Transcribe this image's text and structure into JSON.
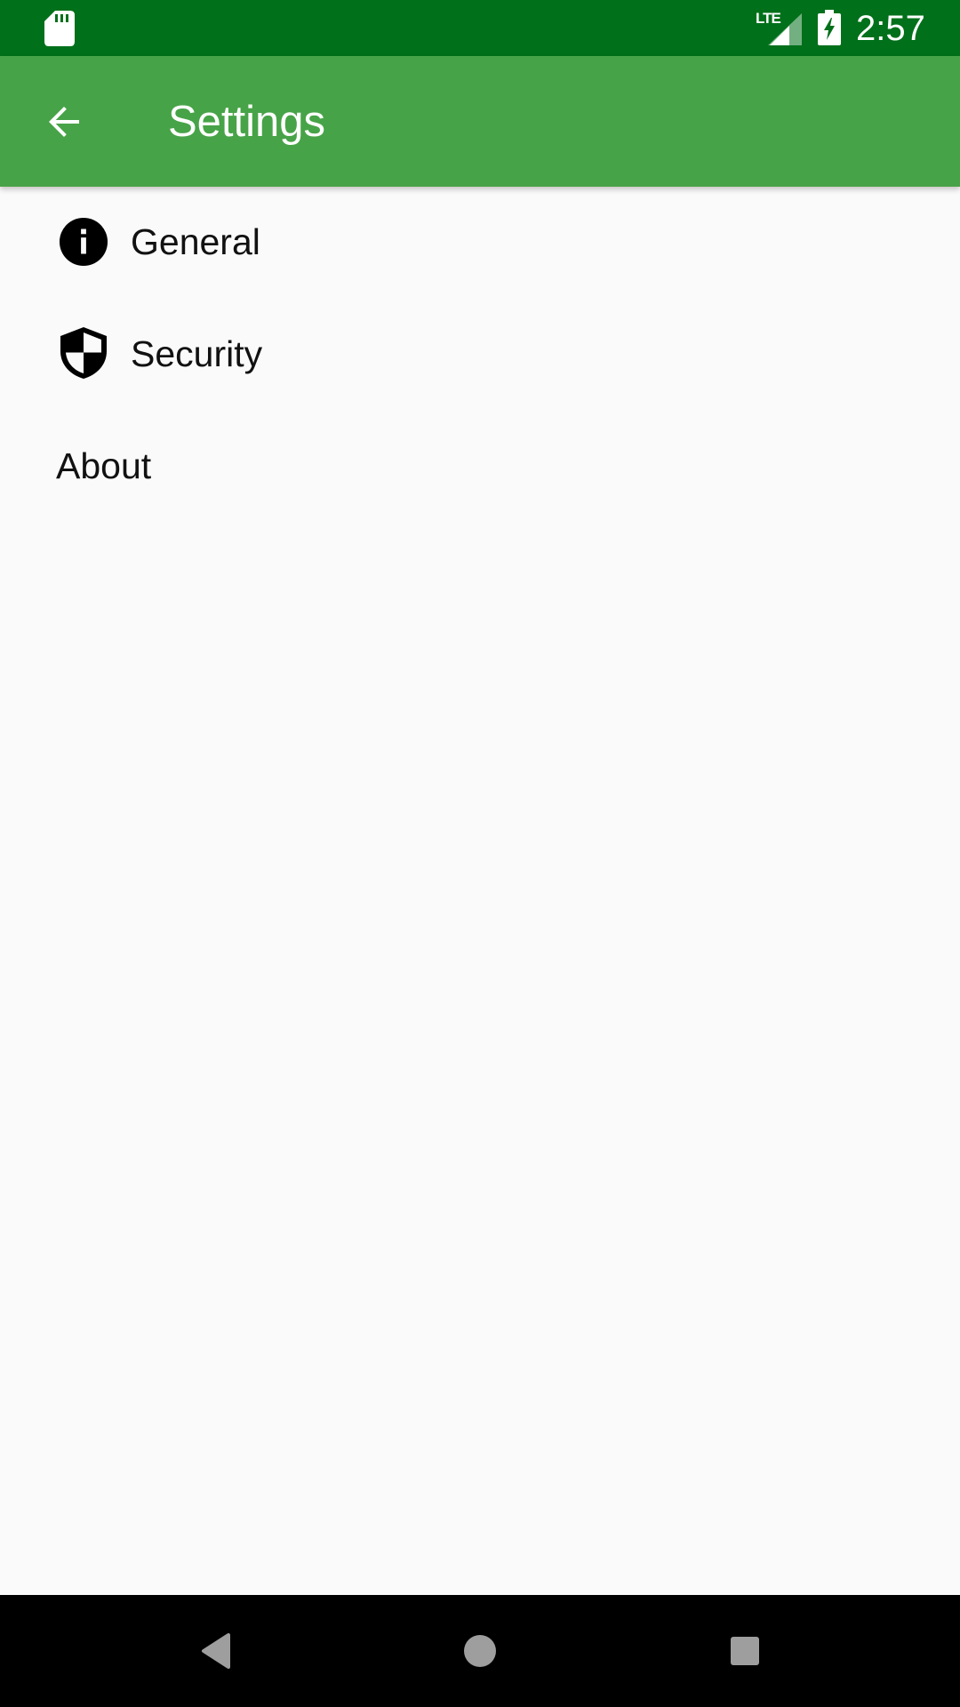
{
  "status_bar": {
    "time": "2:57",
    "network": "LTE",
    "icons": [
      "sd-card-icon",
      "lte-signal-icon",
      "battery-charging-icon"
    ]
  },
  "app_bar": {
    "title": "Settings",
    "back_icon": "arrow-back-icon",
    "color": "#47a347"
  },
  "settings": {
    "items": [
      {
        "label": "General",
        "icon": "info-icon"
      },
      {
        "label": "Security",
        "icon": "shield-icon"
      },
      {
        "label": "About",
        "icon": ""
      }
    ]
  },
  "nav_bar": {
    "buttons": [
      "back-triangle-icon",
      "home-circle-icon",
      "recents-square-icon"
    ]
  },
  "colors": {
    "status_bar": "#00701a",
    "app_bar": "#47a347",
    "background": "#fafafa"
  }
}
